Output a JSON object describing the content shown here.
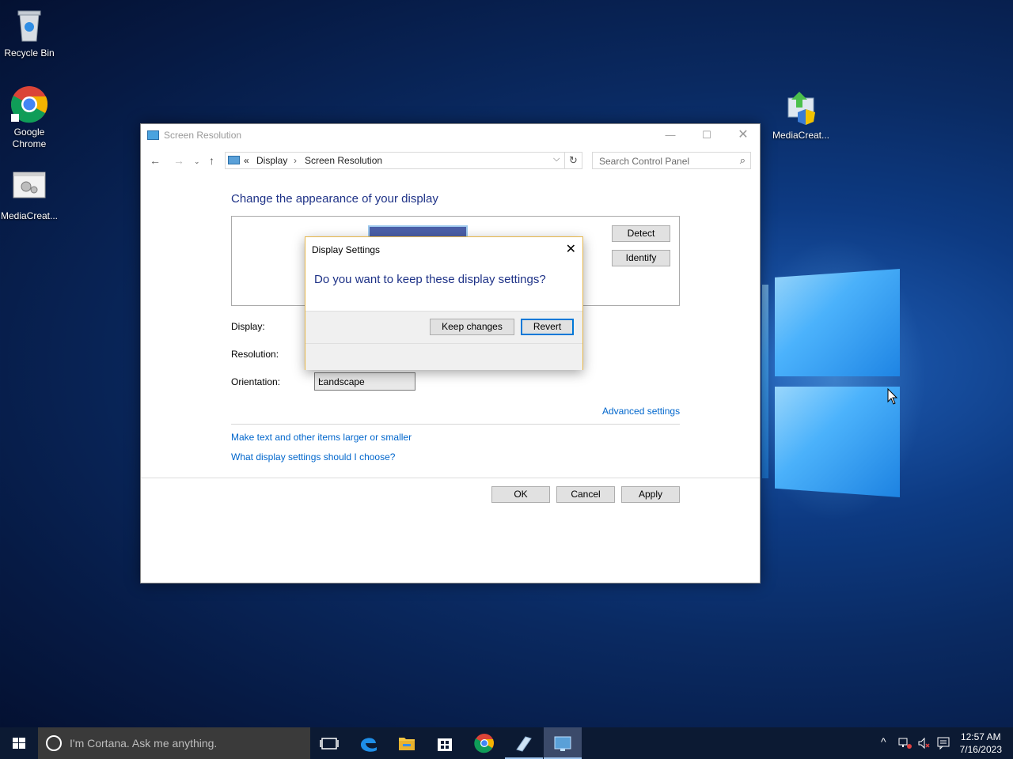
{
  "desktop": {
    "icons": [
      {
        "label": "Recycle Bin"
      },
      {
        "label": "Google Chrome"
      },
      {
        "label": "MediaCreat..."
      },
      {
        "label": "MediaCreat..."
      }
    ]
  },
  "window": {
    "title": "Screen Resolution",
    "breadcrumb": {
      "sep": "«",
      "item1": "Display",
      "arrow": "›",
      "item2": "Screen Resolution"
    },
    "search_placeholder": "Search Control Panel",
    "heading": "Change the appearance of your display",
    "detect_label": "Detect",
    "identify_label": "Identify",
    "display_label": "Display:",
    "resolution_label": "Resolution:",
    "orientation_label": "Orientation:",
    "orientation_value": "Landscape",
    "advanced_link": "Advanced settings",
    "link1": "Make text and other items larger or smaller",
    "link2": "What display settings should I choose?",
    "ok_label": "OK",
    "cancel_label": "Cancel",
    "apply_label": "Apply"
  },
  "dialog": {
    "title": "Display Settings",
    "question": "Do you want to keep these display settings?",
    "keep_label": "Keep changes",
    "revert_label": "Revert"
  },
  "taskbar": {
    "cortana_placeholder": "I'm Cortana. Ask me anything.",
    "time": "12:57 AM",
    "date": "7/16/2023"
  },
  "colors": {
    "accent": "#0078d7",
    "heading": "#1e3287",
    "link": "#0066cc",
    "dialog_border": "#e6b64a"
  }
}
